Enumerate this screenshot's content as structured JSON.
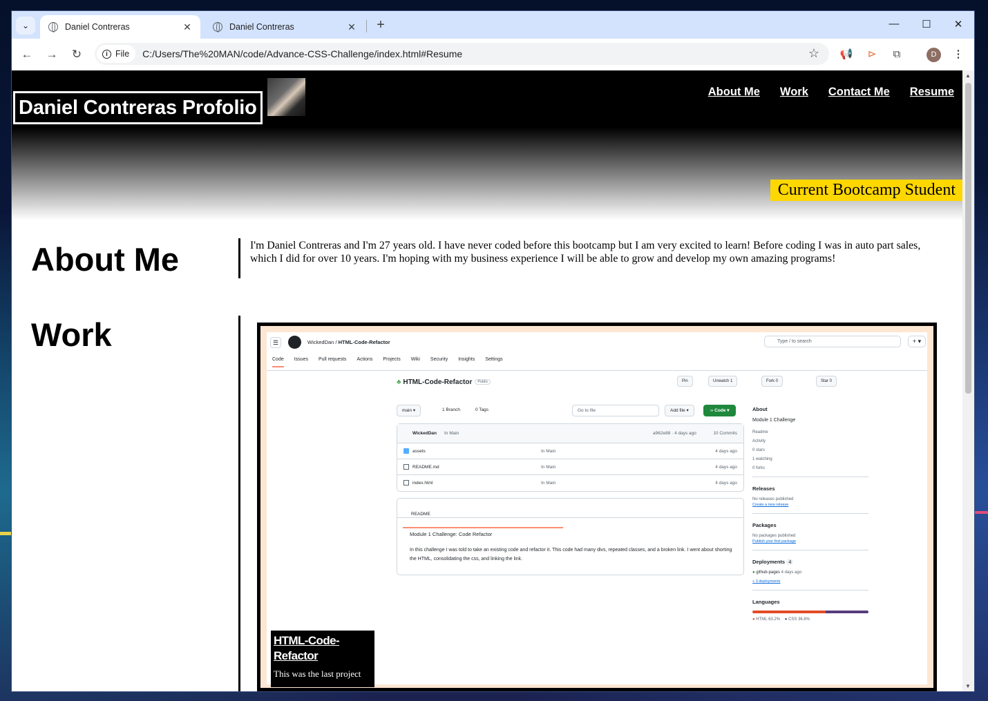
{
  "browser": {
    "tabs": [
      {
        "title": "Daniel Contreras",
        "active": true
      },
      {
        "title": "Daniel Contreras",
        "active": false
      }
    ],
    "new_tab": "+",
    "close": "✕",
    "controls": {
      "minimize": "—",
      "maximize": "☐",
      "close": "✕"
    },
    "omnibox": {
      "chip": "File",
      "url": "C:/Users/The%20MAN/code/Advance-CSS-Challenge/index.html#Resume"
    },
    "profile_initial": "D"
  },
  "header": {
    "brand": "Daniel Contreras Profolio",
    "nav": [
      "About Me",
      "Work",
      "Contact Me",
      "Resume"
    ],
    "badge": "Current Bootcamp Student"
  },
  "about": {
    "title": "About Me",
    "text": "I'm Daniel Contreras and I'm 27 years old. I have never coded before this bootcamp but I am very excited to learn! Before coding I was in auto part sales, which I did for over 10 years. I'm hoping with my business experience I will be able to grow and develop my own amazing programs!"
  },
  "work": {
    "title": "Work",
    "project": {
      "title": "HTML-Code-Refactor",
      "desc": "This was the last project"
    },
    "screenshot": {
      "owner": "WickedDan",
      "repo": "HTML-Code-Refactor",
      "visibility": "Public",
      "search": "Type / to search",
      "tabs": [
        "Code",
        "Issues",
        "Pull requests",
        "Actions",
        "Projects",
        "Wiki",
        "Security",
        "Insights",
        "Settings"
      ],
      "buttons": [
        "Pin",
        "Unwatch 1",
        "Fork 0",
        "Star 0"
      ],
      "branch": "main",
      "branches": "1 Branch",
      "tags": "0 Tags",
      "go_to_file": "Go to file",
      "add_file": "Add file",
      "code": "Code",
      "commit_author": "WickedDan",
      "commit_msg": "In Main",
      "commit_meta": "a962e88 · 4 days ago",
      "commits": "10 Commits",
      "files": [
        {
          "name": "assets",
          "msg": "In Main",
          "age": "4 days ago"
        },
        {
          "name": "README.md",
          "msg": "In Main",
          "age": "4 days ago"
        },
        {
          "name": "index.html",
          "msg": "In Main",
          "age": "4 days ago"
        }
      ],
      "readme_tab": "README",
      "readme_title": "Module 1 Challenge: Code Refactor",
      "readme_body": "In this challenge I was told to take an existing code and refactor it. This code had many divs, repeated classes, and a broken link. I went about shorting the HTML, consolidating the css, and linking the link.",
      "about_h": "About",
      "about_desc": "Module 1 Challenge",
      "about_items": [
        "Readme",
        "Activity",
        "0 stars",
        "1 watching",
        "0 forks"
      ],
      "releases_h": "Releases",
      "releases_none": "No releases published",
      "releases_link": "Create a new release",
      "packages_h": "Packages",
      "packages_none": "No packages published",
      "packages_link": "Publish your first package",
      "deployments_h": "Deployments",
      "deployments_count": "4",
      "deploy_item": "github-pages",
      "deploy_age": "4 days ago",
      "deploy_more": "+ 3 deployments",
      "languages_h": "Languages",
      "languages": [
        {
          "name": "HTML",
          "pct": "63.2%",
          "color": "#e34c26"
        },
        {
          "name": "CSS",
          "pct": "36.8%",
          "color": "#563d7c"
        }
      ]
    }
  },
  "colors": {
    "badge": "#ffd700",
    "hero": "#000000"
  }
}
